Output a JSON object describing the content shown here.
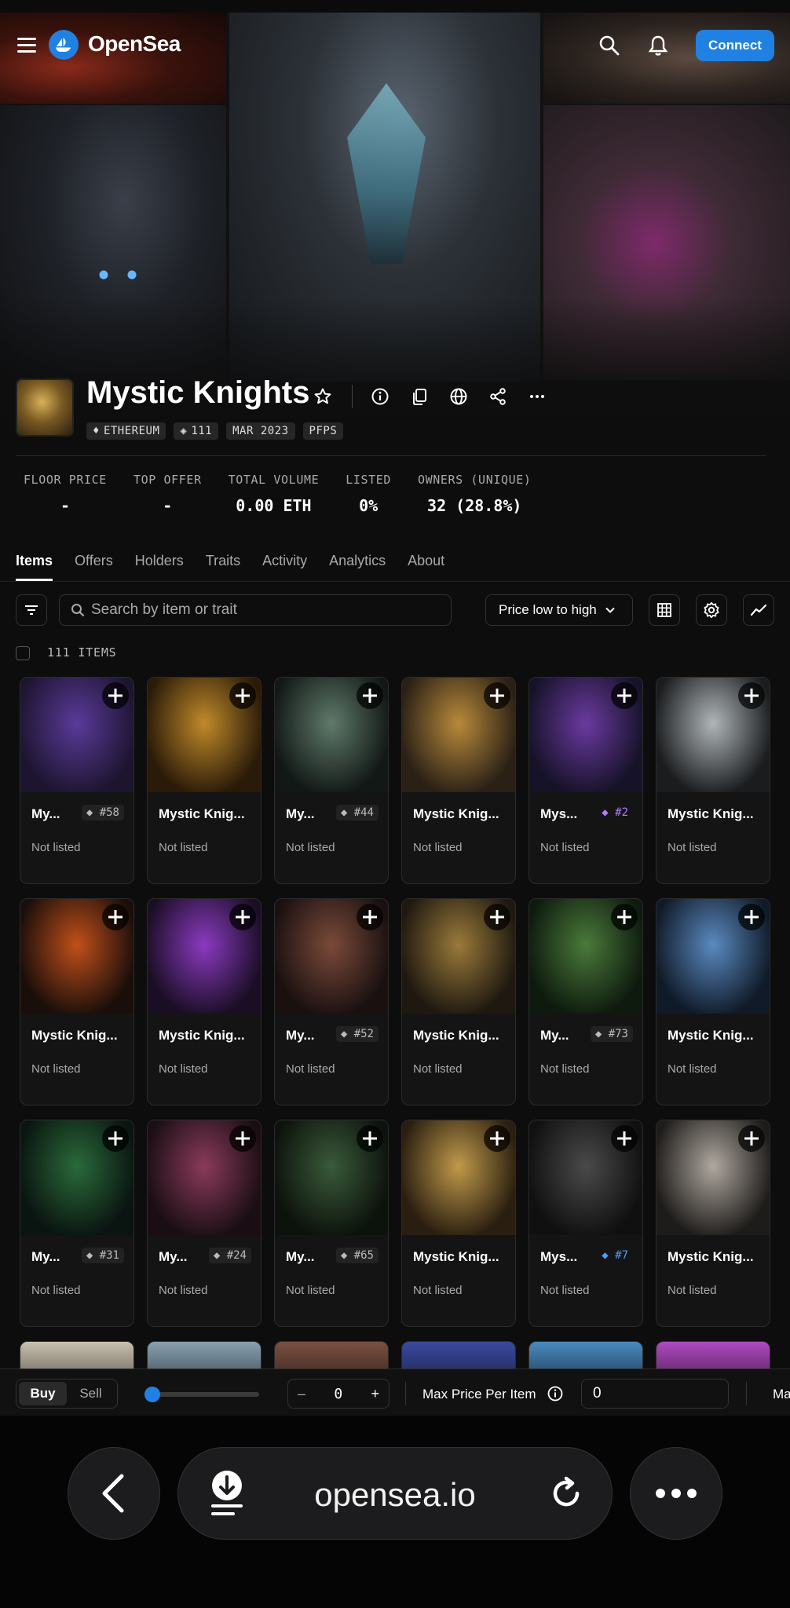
{
  "nav": {
    "brand": "OpenSea",
    "connect_label": "Connect"
  },
  "collection": {
    "title": "Mystic Knights",
    "tags": {
      "chain": "ETHEREUM",
      "supply": "111",
      "date": "MAR 2023",
      "category": "PFPS"
    }
  },
  "stats": [
    {
      "label": "FLOOR PRICE",
      "value": "-"
    },
    {
      "label": "TOP OFFER",
      "value": "-"
    },
    {
      "label": "TOTAL VOLUME",
      "value": "0.00 ETH"
    },
    {
      "label": "LISTED",
      "value": "0%"
    },
    {
      "label": "OWNERS (UNIQUE)",
      "value": "32 (28.8%)"
    }
  ],
  "tabs": [
    "Items",
    "Offers",
    "Holders",
    "Traits",
    "Activity",
    "Analytics",
    "About"
  ],
  "toolbar": {
    "search_placeholder": "Search by item or trait",
    "sort_label": "Price low to high",
    "items_count": "111 ITEMS"
  },
  "items": [
    {
      "name": "My...",
      "rank": "#58",
      "status": "Not listed",
      "c1": "#5a3a9a",
      "c2": "#1d1530"
    },
    {
      "name": "Mystic Knig...",
      "rank": "",
      "status": "Not listed",
      "c1": "#c08a2a",
      "c2": "#2a1a08"
    },
    {
      "name": "My...",
      "rank": "#44",
      "status": "Not listed",
      "c1": "#5f7a6a",
      "c2": "#121816"
    },
    {
      "name": "Mystic Knig...",
      "rank": "",
      "status": "Not listed",
      "c1": "#b88a3a",
      "c2": "#2a2016"
    },
    {
      "name": "Mys...",
      "rank": "#2",
      "status": "Not listed",
      "c1": "#6a3aa0",
      "c2": "#161228"
    },
    {
      "name": "Mystic Knig...",
      "rank": "",
      "status": "Not listed",
      "c1": "#b0b6b8",
      "c2": "#1a1c1e"
    },
    {
      "name": "Mystic Knig...",
      "rank": "",
      "status": "Not listed",
      "c1": "#c0501a",
      "c2": "#1a0e0a"
    },
    {
      "name": "Mystic Knig...",
      "rank": "",
      "status": "Not listed",
      "c1": "#8a3ac0",
      "c2": "#1a0e24"
    },
    {
      "name": "My...",
      "rank": "#52",
      "status": "Not listed",
      "c1": "#7a4a3a",
      "c2": "#1a1010"
    },
    {
      "name": "Mystic Knig...",
      "rank": "",
      "status": "Not listed",
      "c1": "#9a7a3a",
      "c2": "#1e1810"
    },
    {
      "name": "My...",
      "rank": "#73",
      "status": "Not listed",
      "c1": "#4a7a3a",
      "c2": "#0e1a0e"
    },
    {
      "name": "Mystic Knig...",
      "rank": "",
      "status": "Not listed",
      "c1": "#5a8ac0",
      "c2": "#101a28"
    },
    {
      "name": "My...",
      "rank": "#31",
      "status": "Not listed",
      "c1": "#2a6a3a",
      "c2": "#0a1410"
    },
    {
      "name": "My...",
      "rank": "#24",
      "status": "Not listed",
      "c1": "#8a3a5a",
      "c2": "#1a0e14"
    },
    {
      "name": "My...",
      "rank": "#65",
      "status": "Not listed",
      "c1": "#3a5a3a",
      "c2": "#0c120c"
    },
    {
      "name": "Mystic Knig...",
      "rank": "",
      "status": "Not listed",
      "c1": "#c09a4a",
      "c2": "#2a1e10"
    },
    {
      "name": "Mys...",
      "rank": "#7",
      "status": "Not listed",
      "c1": "#4a4a4a",
      "c2": "#101010"
    },
    {
      "name": "Mystic Knig...",
      "rank": "",
      "status": "Not listed",
      "c1": "#b0a8a0",
      "c2": "#1e1c1a"
    }
  ],
  "rank_colors": {
    "default": "#bbbbbb",
    "purple": "#b57cff",
    "blue": "#4a9eff"
  },
  "buybar": {
    "buy_label": "Buy",
    "sell_label": "Sell",
    "quantity": "0",
    "minus": "–",
    "plus": "+",
    "max_price_label": "Max Price Per Item",
    "max_price_value": "0",
    "cut_label": "Ma"
  },
  "browser": {
    "url": "opensea.io"
  },
  "colors": {
    "accent": "#2081e2",
    "background": "#0d0d0d"
  }
}
